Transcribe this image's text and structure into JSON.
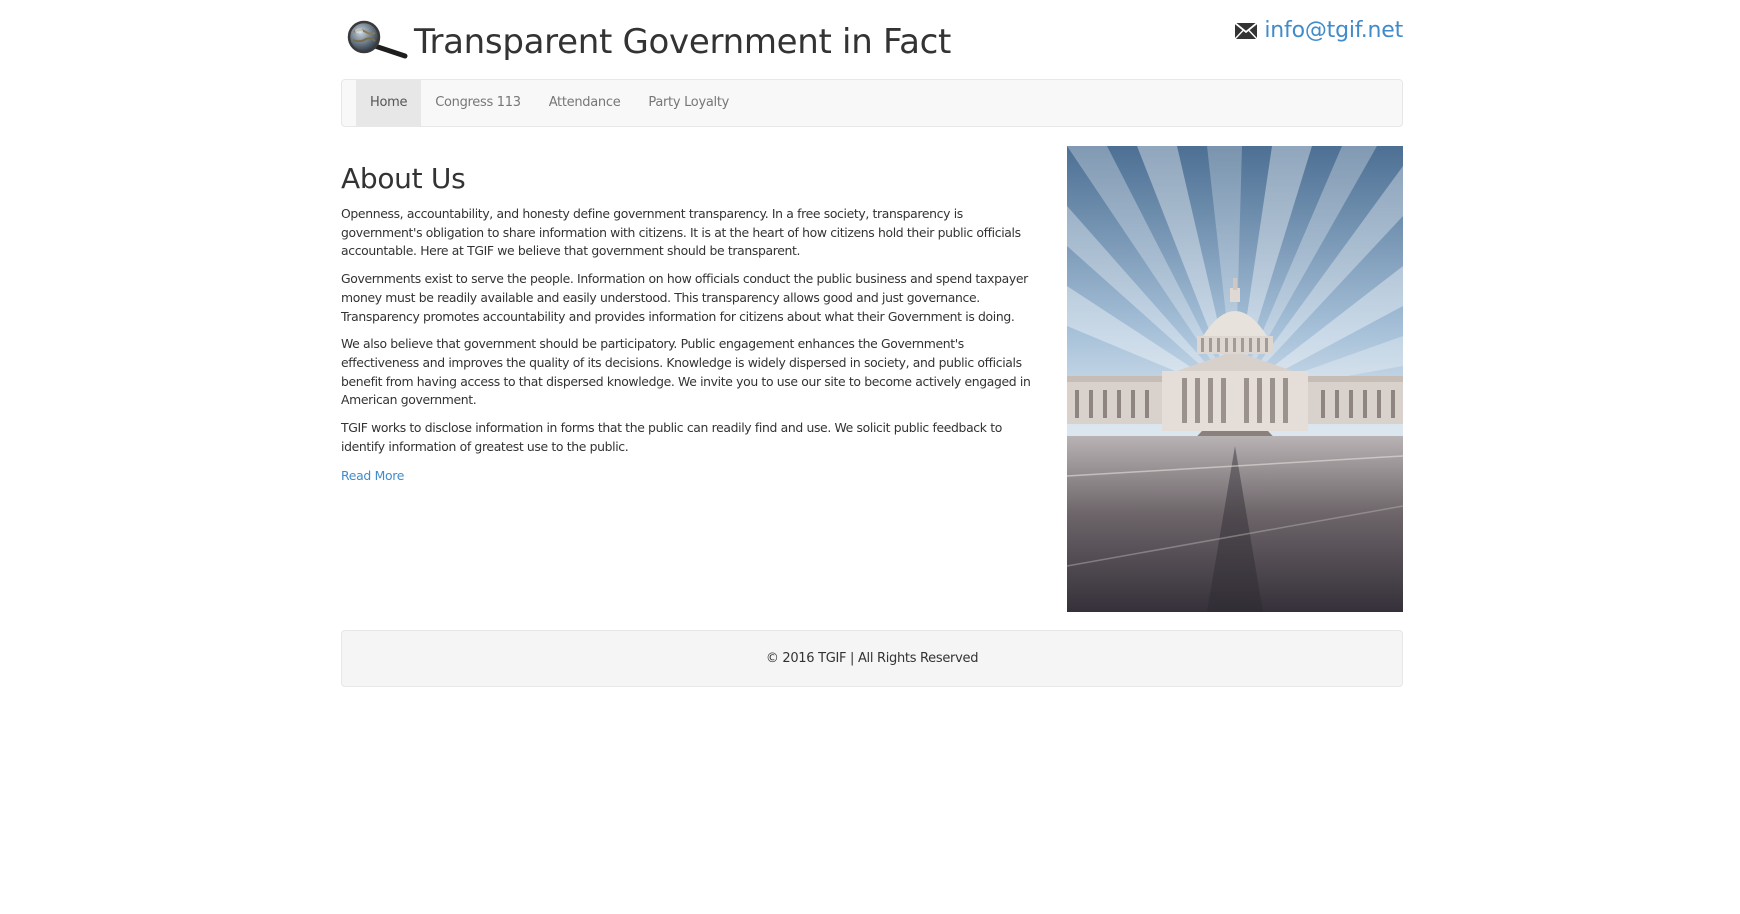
{
  "header": {
    "logo_icon": "magnifying-glass-globe-icon",
    "title": "Transparent Government in Fact",
    "contact_icon": "envelope-icon",
    "contact_email": "info@tgif.net"
  },
  "nav": {
    "items": [
      {
        "label": "Home",
        "active": true
      },
      {
        "label": "Congress 113",
        "active": false
      },
      {
        "label": "Attendance",
        "active": false
      },
      {
        "label": "Party Loyalty",
        "active": false
      }
    ]
  },
  "about": {
    "heading": "About Us",
    "paragraphs": [
      "Openness, accountability, and honesty define government transparency. In a free society, transparency is government's obligation to share information with citizens. It is at the heart of how citizens hold their public officials accountable. Here at TGIF we believe that government should be transparent.",
      "Governments exist to serve the people. Information on how officials conduct the public business and spend taxpayer money must be readily available and easily understood. This transparency allows good and just governance. Transparency promotes accountability and provides information for citizens about what their Government is doing.",
      "We also believe that government should be participatory. Public engagement enhances the Government's effectiveness and improves the quality of its decisions. Knowledge is widely dispersed in society, and public officials benefit from having access to that dispersed knowledge. We invite you to use our site to become actively engaged in American government.",
      "TGIF works to disclose information in forms that the public can readily find and use. We solicit public feedback to identify information of greatest use to the public."
    ],
    "read_more": "Read More"
  },
  "photo": {
    "subject": "capitol-building-photo"
  },
  "footer": {
    "text": "© 2016 TGIF | All Rights Reserved"
  },
  "colors": {
    "link": "#428bca",
    "navbar_bg": "#f8f8f8",
    "nav_active_bg": "#e7e7e7",
    "footer_bg": "#f5f5f5"
  }
}
